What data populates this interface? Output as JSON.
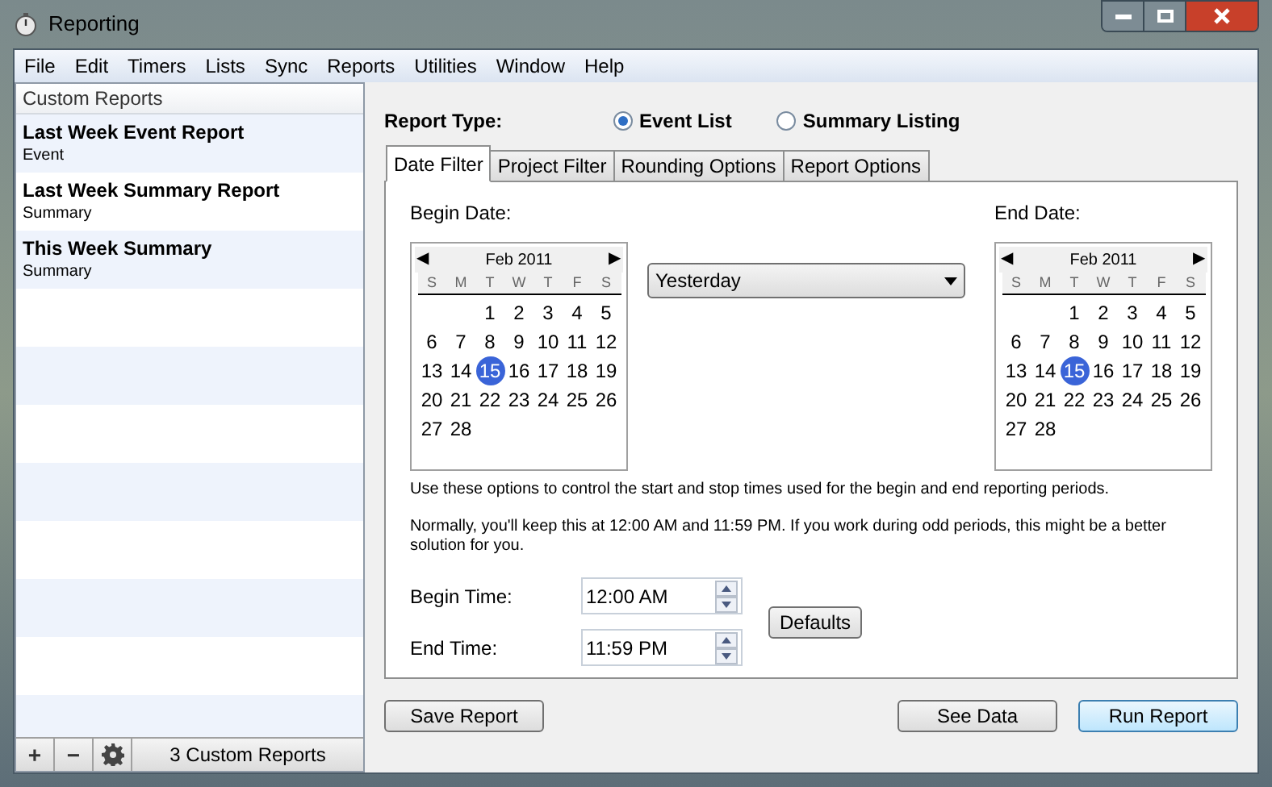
{
  "window": {
    "title": "Reporting"
  },
  "menu": [
    "File",
    "Edit",
    "Timers",
    "Lists",
    "Sync",
    "Reports",
    "Utilities",
    "Window",
    "Help"
  ],
  "sidebar": {
    "header": "Custom Reports",
    "items": [
      {
        "title": "Last Week Event Report",
        "subtitle": "Event",
        "selected": false
      },
      {
        "title": "Last Week Summary Report",
        "subtitle": "Summary",
        "selected": false
      },
      {
        "title": "This Week Summary",
        "subtitle": "Summary",
        "selected": false
      }
    ],
    "toolbar": [
      {
        "kind": "add",
        "label": "+"
      },
      {
        "kind": "remove",
        "label": "−"
      },
      {
        "kind": "settings"
      }
    ],
    "count": "3 Custom Reports"
  },
  "report_type": {
    "label": "Report Type:",
    "options": [
      {
        "label": "Event List",
        "selected": true
      },
      {
        "label": "Summary Listing",
        "selected": false
      }
    ]
  },
  "tabs": [
    {
      "label": "Date Filter",
      "selected": true
    },
    {
      "label": "Project Filter",
      "selected": false
    },
    {
      "label": "Rounding Options",
      "selected": false
    },
    {
      "label": "Report Options",
      "selected": false
    }
  ],
  "calendars": [
    {
      "label": "Begin Date:",
      "month": "Feb 2011",
      "prev": "◀",
      "next": "▶",
      "weekdays": [
        "S",
        "M",
        "T",
        "W",
        "T",
        "F",
        "S"
      ],
      "days": [
        {
          "kind": "blank"
        },
        {
          "kind": "blank"
        },
        {
          "kind": "day",
          "text": "1",
          "selected": false
        },
        {
          "kind": "day",
          "text": "2",
          "selected": false
        },
        {
          "kind": "day",
          "text": "3",
          "selected": false
        },
        {
          "kind": "day",
          "text": "4",
          "selected": false
        },
        {
          "kind": "day",
          "text": "5",
          "selected": false
        },
        {
          "kind": "day",
          "text": "6",
          "selected": false
        },
        {
          "kind": "day",
          "text": "7",
          "selected": false
        },
        {
          "kind": "day",
          "text": "8",
          "selected": false
        },
        {
          "kind": "day",
          "text": "9",
          "selected": false
        },
        {
          "kind": "day",
          "text": "10",
          "selected": false
        },
        {
          "kind": "day",
          "text": "11",
          "selected": false
        },
        {
          "kind": "day",
          "text": "12",
          "selected": false
        },
        {
          "kind": "day",
          "text": "13",
          "selected": false
        },
        {
          "kind": "day",
          "text": "14",
          "selected": false
        },
        {
          "kind": "day",
          "text": "15",
          "selected": true
        },
        {
          "kind": "day",
          "text": "16",
          "selected": false
        },
        {
          "kind": "day",
          "text": "17",
          "selected": false
        },
        {
          "kind": "day",
          "text": "18",
          "selected": false
        },
        {
          "kind": "day",
          "text": "19",
          "selected": false
        },
        {
          "kind": "day",
          "text": "20",
          "selected": false
        },
        {
          "kind": "day",
          "text": "21",
          "selected": false
        },
        {
          "kind": "day",
          "text": "22",
          "selected": false
        },
        {
          "kind": "day",
          "text": "23",
          "selected": false
        },
        {
          "kind": "day",
          "text": "24",
          "selected": false
        },
        {
          "kind": "day",
          "text": "25",
          "selected": false
        },
        {
          "kind": "day",
          "text": "26",
          "selected": false
        },
        {
          "kind": "day",
          "text": "27",
          "selected": false
        },
        {
          "kind": "day",
          "text": "28",
          "selected": false
        }
      ]
    },
    {
      "label": "End Date:",
      "month": "Feb 2011",
      "prev": "◀",
      "next": "▶",
      "weekdays": [
        "S",
        "M",
        "T",
        "W",
        "T",
        "F",
        "S"
      ],
      "days": [
        {
          "kind": "blank"
        },
        {
          "kind": "blank"
        },
        {
          "kind": "day",
          "text": "1",
          "selected": false
        },
        {
          "kind": "day",
          "text": "2",
          "selected": false
        },
        {
          "kind": "day",
          "text": "3",
          "selected": false
        },
        {
          "kind": "day",
          "text": "4",
          "selected": false
        },
        {
          "kind": "day",
          "text": "5",
          "selected": false
        },
        {
          "kind": "day",
          "text": "6",
          "selected": false
        },
        {
          "kind": "day",
          "text": "7",
          "selected": false
        },
        {
          "kind": "day",
          "text": "8",
          "selected": false
        },
        {
          "kind": "day",
          "text": "9",
          "selected": false
        },
        {
          "kind": "day",
          "text": "10",
          "selected": false
        },
        {
          "kind": "day",
          "text": "11",
          "selected": false
        },
        {
          "kind": "day",
          "text": "12",
          "selected": false
        },
        {
          "kind": "day",
          "text": "13",
          "selected": false
        },
        {
          "kind": "day",
          "text": "14",
          "selected": false
        },
        {
          "kind": "day",
          "text": "15",
          "selected": true
        },
        {
          "kind": "day",
          "text": "16",
          "selected": false
        },
        {
          "kind": "day",
          "text": "17",
          "selected": false
        },
        {
          "kind": "day",
          "text": "18",
          "selected": false
        },
        {
          "kind": "day",
          "text": "19",
          "selected": false
        },
        {
          "kind": "day",
          "text": "20",
          "selected": false
        },
        {
          "kind": "day",
          "text": "21",
          "selected": false
        },
        {
          "kind": "day",
          "text": "22",
          "selected": false
        },
        {
          "kind": "day",
          "text": "23",
          "selected": false
        },
        {
          "kind": "day",
          "text": "24",
          "selected": false
        },
        {
          "kind": "day",
          "text": "25",
          "selected": false
        },
        {
          "kind": "day",
          "text": "26",
          "selected": false
        },
        {
          "kind": "day",
          "text": "27",
          "selected": false
        },
        {
          "kind": "day",
          "text": "28",
          "selected": false
        }
      ]
    }
  ],
  "preset": {
    "value": "Yesterday"
  },
  "notes": [
    "Use these options to control the start and stop times used for the begin and end reporting periods.",
    "Normally, you'll keep this at 12:00 AM and 11:59 PM.  If you work during odd periods, this might be a better solution for you."
  ],
  "times": [
    {
      "label": "Begin Time:",
      "value": "12:00 AM"
    },
    {
      "label": "End Time:",
      "value": "11:59 PM"
    }
  ],
  "defaults_button": "Defaults",
  "buttons": [
    {
      "label": "Save Report",
      "kind": "left"
    },
    {
      "label": "See Data",
      "kind": "right"
    },
    {
      "label": "Run Report",
      "kind": "default"
    }
  ]
}
